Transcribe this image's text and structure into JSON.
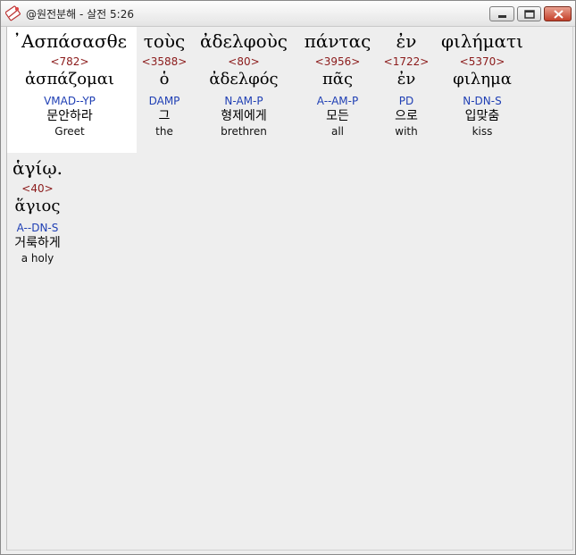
{
  "window": {
    "title": "@원전분해 - 살전 5:26",
    "icon": "bible-app-icon"
  },
  "controls": {
    "minimize_icon": "minimize-icon",
    "maximize_icon": "maximize-icon",
    "close_icon": "close-icon"
  },
  "colors": {
    "strong": "#8b1a1a",
    "parse": "#1f3fb4",
    "highlight_bg": "#ffffff",
    "panel_bg": "#eeeeee"
  },
  "words": [
    {
      "greek": "᾿Ασπάσασθε",
      "strong": "<782>",
      "lemma": "ἀσπάζομαι",
      "parse": "VMAD--YP",
      "korean": "문안하라",
      "english": "Greet"
    },
    {
      "greek": "τοὺς",
      "strong": "<3588>",
      "lemma": "ὁ",
      "parse": "DAMP",
      "korean": "그",
      "english": "the"
    },
    {
      "greek": "ἀδελφοὺς",
      "strong": "<80>",
      "lemma": "ἀδελφός",
      "parse": "N-AM-P",
      "korean": "형제에게",
      "english": "brethren"
    },
    {
      "greek": "πάντας",
      "strong": "<3956>",
      "lemma": "πᾶς",
      "parse": "A--AM-P",
      "korean": "모든",
      "english": "all"
    },
    {
      "greek": "ἐν",
      "strong": "<1722>",
      "lemma": "ἐν",
      "parse": "PD",
      "korean": "으로",
      "english": "with"
    },
    {
      "greek": "φιλήματι",
      "strong": "<5370>",
      "lemma": "φιλημα",
      "parse": "N-DN-S",
      "korean": "입맞춤",
      "english": "kiss"
    },
    {
      "greek": "ἁγίῳ.",
      "strong": "<40>",
      "lemma": "ἅγιος",
      "parse": "A--DN-S",
      "korean": "거룩하게",
      "english": "a holy"
    }
  ]
}
